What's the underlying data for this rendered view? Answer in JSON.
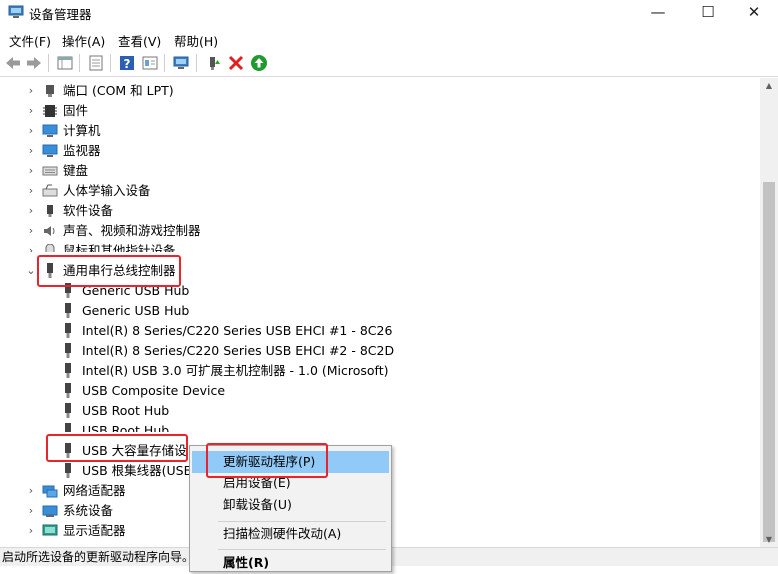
{
  "window": {
    "title": "设备管理器",
    "minimize": "—",
    "maximize": "☐",
    "close": "✕"
  },
  "menu": [
    "文件(F)",
    "操作(A)",
    "查看(V)",
    "帮助(H)"
  ],
  "tree": {
    "categories": [
      {
        "label": "端口 (COM 和 LPT)",
        "icon": "port-icon"
      },
      {
        "label": "固件",
        "icon": "firmware-icon"
      },
      {
        "label": "计算机",
        "icon": "computer-icon"
      },
      {
        "label": "监视器",
        "icon": "monitor-icon"
      },
      {
        "label": "键盘",
        "icon": "keyboard-icon"
      },
      {
        "label": "人体学输入设备",
        "icon": "hid-icon"
      },
      {
        "label": "软件设备",
        "icon": "software-device-icon"
      },
      {
        "label": "声音、视频和游戏控制器",
        "icon": "audio-icon"
      },
      {
        "label": "鼠标和其他指针设备",
        "icon": "mouse-icon"
      }
    ],
    "usb_category": "通用串行总线控制器",
    "usb_devices": [
      "Generic USB Hub",
      "Generic USB Hub",
      "Intel(R) 8 Series/C220 Series USB EHCI #1 - 8C26",
      "Intel(R) 8 Series/C220 Series USB EHCI #2 - 8C2D",
      "Intel(R) USB 3.0 可扩展主机控制器 - 1.0 (Microsoft)",
      "USB Composite Device",
      "USB Root Hub",
      "USB Root Hub",
      "USB 大容量存储设",
      "USB 根集线器(USB"
    ],
    "after": [
      {
        "label": "网络适配器",
        "icon": "network-icon"
      },
      {
        "label": "系统设备",
        "icon": "system-icon"
      },
      {
        "label": "显示适配器",
        "icon": "display-adapter-icon"
      }
    ]
  },
  "context_menu": {
    "items": [
      "更新驱动程序(P)",
      "启用设备(E)",
      "卸载设备(U)",
      "扫描检测硬件改动(A)",
      "属性(R)"
    ]
  },
  "status": "启动所选设备的更新驱动程序向导。",
  "colors": {
    "highlight": "#91c9f7",
    "annotation": "#e8242c"
  }
}
